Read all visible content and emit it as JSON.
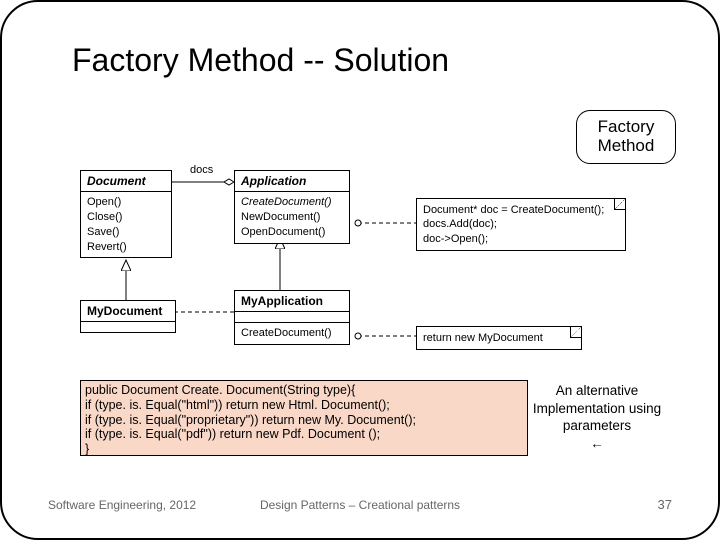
{
  "title": "Factory Method -- Solution",
  "bubble_label": "Factory Method",
  "uml": {
    "document": {
      "name": "Document",
      "ops": [
        "Open()",
        "Close()",
        "Save()",
        "Revert()"
      ]
    },
    "application": {
      "name": "Application",
      "ops": [
        "CreateDocument()",
        "NewDocument()",
        "OpenDocument()"
      ]
    },
    "mydocument": {
      "name": "MyDocument"
    },
    "myapplication": {
      "name": "MyApplication",
      "ops": [
        "CreateDocument()"
      ]
    },
    "docs_label": "docs",
    "note1": [
      "Document* doc = CreateDocument();",
      "docs.Add(doc);",
      "doc->Open();"
    ],
    "note2": "return new MyDocument"
  },
  "code_lines": [
    "public Document Create. Document(String type){",
    " if (type. is. Equal(\"html\"))   return new Html. Document();",
    " if (type. is. Equal(\"proprietary\")) return new My. Document();",
    "  if (type. is. Equal(\"pdf\")) return new Pdf. Document ();",
    "}"
  ],
  "alt_text": [
    "An alternative",
    "Implementation using",
    "parameters",
    "←"
  ],
  "footer": {
    "left": "Software Engineering, 2012",
    "center": "Design Patterns – Creational patterns",
    "page": "37"
  }
}
